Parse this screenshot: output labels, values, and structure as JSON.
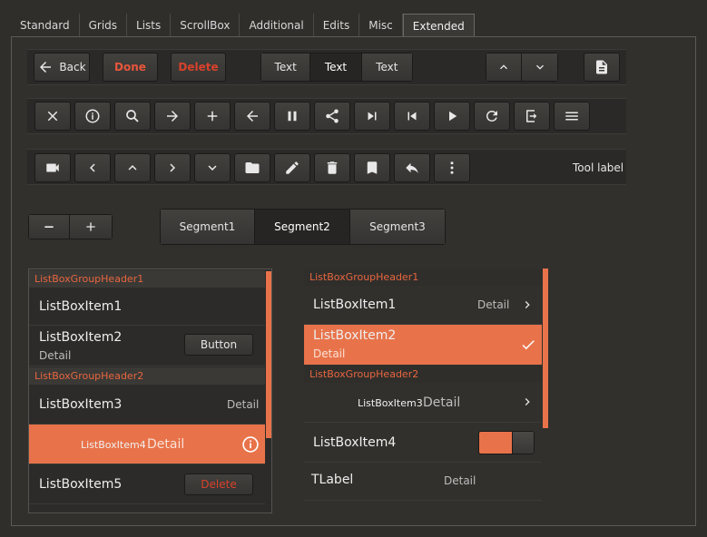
{
  "tabs": [
    "Standard",
    "Grids",
    "Lists",
    "ScrollBox",
    "Additional",
    "Edits",
    "Misc",
    "Extended"
  ],
  "active_tab": "Extended",
  "toolbar1": {
    "back": "Back",
    "done": "Done",
    "delete": "Delete",
    "segments": [
      "Text",
      "Text",
      "Text"
    ]
  },
  "toolbar3": {
    "tool_label": "Tool label"
  },
  "segments": [
    "Segment1",
    "Segment2",
    "Segment3"
  ],
  "list_left": {
    "header1": "ListBoxGroupHeader1",
    "item1": "ListBoxItem1",
    "item2": "ListBoxItem2",
    "item2_detail": "Detail",
    "item2_button": "Button",
    "header2": "ListBoxGroupHeader2",
    "item3": "ListBoxItem3",
    "item3_detail": "Detail",
    "item4": "ListBoxItem4",
    "item4_detail": "Detail",
    "item5": "ListBoxItem5",
    "item5_button": "Delete"
  },
  "list_right": {
    "header1": "ListBoxGroupHeader1",
    "item1": "ListBoxItem1",
    "item1_detail": "Detail",
    "item2": "ListBoxItem2",
    "item2_detail": "Detail",
    "header2": "ListBoxGroupHeader2",
    "item3": "ListBoxItem3",
    "item3_detail": "Detail",
    "item4": "ListBoxItem4",
    "tlabel": "TLabel",
    "tlabel_detail": "Detail"
  },
  "colors": {
    "accent": "#e8734a",
    "header_text": "#e8663f",
    "danger": "#e8563b"
  }
}
